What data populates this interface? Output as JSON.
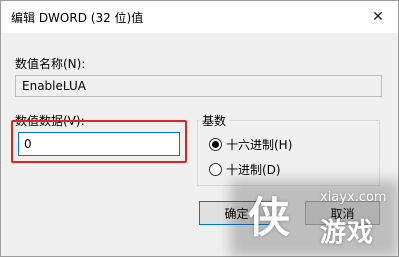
{
  "window": {
    "title": "编辑 DWORD (32 位)值",
    "close_glyph": "✕"
  },
  "name_field": {
    "label": "数值名称(N):",
    "value": "EnableLUA"
  },
  "data_field": {
    "label": "数值数据(V):",
    "value": "0"
  },
  "base_group": {
    "title": "基数",
    "options": [
      {
        "label": "十六进制(H)",
        "selected": true
      },
      {
        "label": "十进制(D)",
        "selected": false
      }
    ]
  },
  "buttons": {
    "ok_label": "确定",
    "cancel_label": "取消"
  },
  "watermark": {
    "url": "xiayx.com",
    "mark": "侠",
    "text": "游戏"
  },
  "colors": {
    "highlight_border": "#e02424",
    "focus_border": "#0078d7"
  }
}
